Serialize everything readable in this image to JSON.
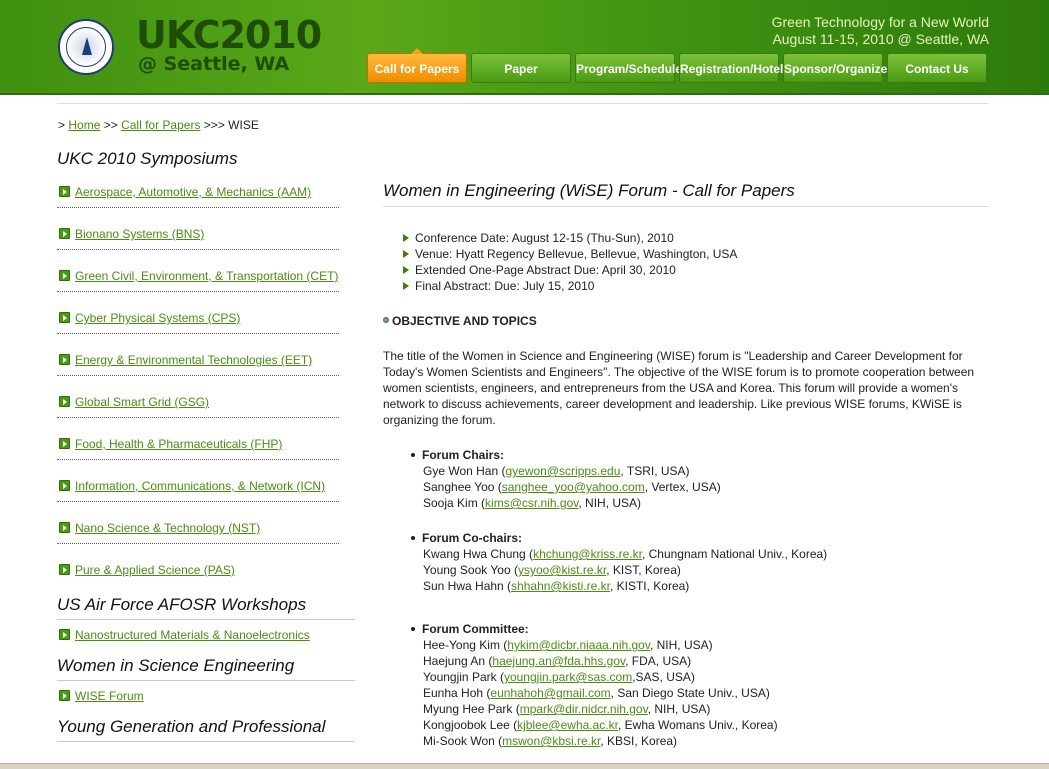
{
  "header": {
    "logo_title": "UKC2010",
    "logo_sub": "@ Seattle, WA",
    "tagline_line1": "Green Technology for a New World",
    "tagline_line2": "August 11-15, 2010 @ Seattle, WA",
    "nav": [
      {
        "label": "Call for Papers"
      },
      {
        "label": "Paper Submission"
      },
      {
        "label": "Program/Schedule"
      },
      {
        "label": "Registration/Hotel"
      },
      {
        "label": "Sponsor/Organizer"
      },
      {
        "label": "Contact Us"
      }
    ]
  },
  "breadcrumb": {
    "prefix": ">",
    "home": "Home",
    "sep1": ">>",
    "call": "Call for Papers",
    "sep2": ">>>",
    "current": "WISE"
  },
  "sidebar": {
    "heading1": "UKC 2010 Symposiums",
    "symposiums": [
      "Aerospace, Automotive, & Mechanics (AAM)",
      "Bionano Systems (BNS)",
      "Green Civil, Environment, & Transportation (CET)",
      "Cyber Physical Systems (CPS)",
      "Energy & Environmental Technologies (EET)",
      "Global Smart Grid (GSG)",
      "Food, Health & Pharmaceuticals (FHP)",
      "Information, Communications, & Network (ICN)",
      "Nano Science & Technology (NST)",
      "Pure & Applied Science (PAS)"
    ],
    "heading2": "US Air Force AFOSR Workshops",
    "workshop": "Nanostructured Materials & Nanoelectronics",
    "heading3": "Women in Science Engineering",
    "wise": "WISE Forum",
    "heading4": "Young Generation and Professional"
  },
  "main": {
    "title": "Women in Engineering (WiSE) Forum - Call for Papers",
    "facts": [
      "Conference Date: August 12-15 (Thu-Sun), 2010",
      "Venue: Hyatt Regency Bellevue, Bellevue, Washington, USA",
      "Extended One-Page Abstract Due: April 30, 2010",
      "Final Abstract: Due: July 15, 2010"
    ],
    "section_title": "OBJECTIVE AND TOPICS",
    "paragraph": "The title of the Women in Science and Engineering (WISE) forum is \"Leadership and Career Development for Today's Women Scientists and Engineers\". The objective of the WISE forum is to promote cooperation between women scientists, engineers, and entrepreneurs from the USA and Korea. This forum will provide a women's network to discuss achievements, career development and leadership. Like previous WISE forums, KWiSE is organizing the forum.",
    "chairs_title": "Forum Chairs:",
    "chairs": [
      {
        "name": "Gye Won Han (",
        "email": "gyewon@scripps.edu",
        "org": ", TSRI, USA)"
      },
      {
        "name": "Sanghee Yoo (",
        "email": "sanghee_yoo@yahoo.com",
        "org": ", Vertex, USA)"
      },
      {
        "name": "Sooja Kim (",
        "email": "kims@csr.nih.gov",
        "org": ", NIH, USA)"
      }
    ],
    "cochairs_title": "Forum Co-chairs:",
    "cochairs": [
      {
        "name": "Kwang Hwa Chung (",
        "email": "khchung@kriss.re.kr",
        "org": ", Chungnam National Univ., Korea)"
      },
      {
        "name": "Young Sook Yoo (",
        "email": "ysyoo@kist.re.kr",
        "org": ", KIST, Korea)"
      },
      {
        "name": "Sun Hwa Hahn (",
        "email": "shhahn@kisti.re.kr",
        "org": ", KISTI, Korea)"
      }
    ],
    "committee_title": "Forum Committee:",
    "committee": [
      {
        "name": "Hee-Yong Kim (",
        "email": "hykim@dicbr.niaaa.nih.gov",
        "org": ", NIH, USA)"
      },
      {
        "name": "Haejung An (",
        "email": "haejung.an@fda.hhs.gov",
        "org": ", FDA, USA)"
      },
      {
        "name": "Youngjin Park (",
        "email": "youngjin.park@sas.com",
        "org": ",SAS, USA)"
      },
      {
        "name": "Eunha Hoh (",
        "email": "eunhahoh@gmail.com",
        "org": ", San Diego State Univ., USA)"
      },
      {
        "name": "Myung Hee Park (",
        "email": "mpark@dir.nidcr.nih.gov",
        "org": ", NIH, USA)"
      },
      {
        "name": "Kongjoobok Lee (",
        "email": "kjblee@ewha.ac.kr",
        "org": ", Ewha Womans Univ., Korea)"
      },
      {
        "name": "Mi-Sook Won (",
        "email": "mswon@kbsi.re.kr",
        "org": ", KBSI, Korea)"
      }
    ]
  }
}
